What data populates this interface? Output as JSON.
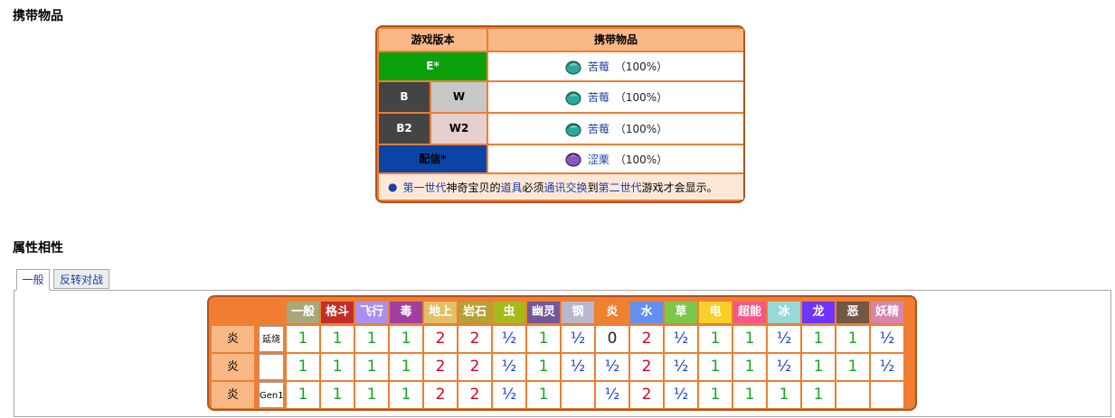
{
  "held_section": {
    "title": "携带物品",
    "header_version": "游戏版本",
    "header_item": "携带物品",
    "rows": [
      {
        "versions": [
          "E*"
        ],
        "colors": [
          "#0aa10a"
        ],
        "item": "苦莓",
        "pct": "（100%）",
        "icon": "berry-green-icon"
      },
      {
        "versions": [
          "B",
          "W"
        ],
        "colors": [
          "#444444",
          "#c8c8c8"
        ],
        "item": "苦莓",
        "pct": "（100%）",
        "icon": "berry-green-icon"
      },
      {
        "versions": [
          "B2",
          "W2"
        ],
        "colors": [
          "#444444",
          "#e6cfcf"
        ],
        "item": "苦莓",
        "pct": "（100%）",
        "icon": "berry-green-icon"
      },
      {
        "versions": [
          "配信*"
        ],
        "colors": [
          "#0a44a6"
        ],
        "item": "涩栗",
        "pct": "（100%）",
        "icon": "berry-purple-icon"
      }
    ],
    "note": {
      "link1": "第一世代",
      "text1": "神奇宝贝的",
      "link2": "道具",
      "text2": "必须",
      "link3": "通讯交换",
      "text3": "到",
      "link4": "第二世代",
      "text4": "游戏才会显示。"
    }
  },
  "type_section": {
    "title": "属性相性",
    "tabs": [
      "一般",
      "反转对战"
    ],
    "types": [
      {
        "name": "一般",
        "color": "#a8a77a"
      },
      {
        "name": "格斗",
        "color": "#c22e28"
      },
      {
        "name": "飞行",
        "color": "#a98ff3"
      },
      {
        "name": "毒",
        "color": "#a33ea1"
      },
      {
        "name": "地上",
        "color": "#e2bf65"
      },
      {
        "name": "岩石",
        "color": "#b6a136"
      },
      {
        "name": "虫",
        "color": "#a6b91a"
      },
      {
        "name": "幽灵",
        "color": "#735797"
      },
      {
        "name": "钢",
        "color": "#b7b7ce"
      },
      {
        "name": "炎",
        "color": "#ee8130"
      },
      {
        "name": "水",
        "color": "#6390f0"
      },
      {
        "name": "草",
        "color": "#7ac74c"
      },
      {
        "name": "电",
        "color": "#f7d02c"
      },
      {
        "name": "超能力",
        "color": "#f95587"
      },
      {
        "name": "冰",
        "color": "#96d9d6"
      },
      {
        "name": "龙",
        "color": "#6f35fc"
      },
      {
        "name": "恶",
        "color": "#705746"
      },
      {
        "name": "妖精",
        "color": "#d685ad"
      }
    ],
    "rows": [
      {
        "type": "炎",
        "sub": "延烧",
        "values": [
          "1",
          "1",
          "1",
          "1",
          "2",
          "2",
          "½",
          "1",
          "½",
          "0",
          "2",
          "½",
          "1",
          "1",
          "½",
          "1",
          "1",
          "½"
        ]
      },
      {
        "type": "炎",
        "sub": "",
        "values": [
          "1",
          "1",
          "1",
          "1",
          "2",
          "2",
          "½",
          "1",
          "½",
          "½",
          "2",
          "½",
          "1",
          "1",
          "½",
          "1",
          "1",
          "½"
        ]
      },
      {
        "type": "炎",
        "sub": "Gen1",
        "values": [
          "1",
          "1",
          "1",
          "1",
          "2",
          "2",
          "½",
          "1",
          "",
          "½",
          "2",
          "½",
          "1",
          "1",
          "1",
          "1",
          "",
          ""
        ]
      }
    ]
  }
}
